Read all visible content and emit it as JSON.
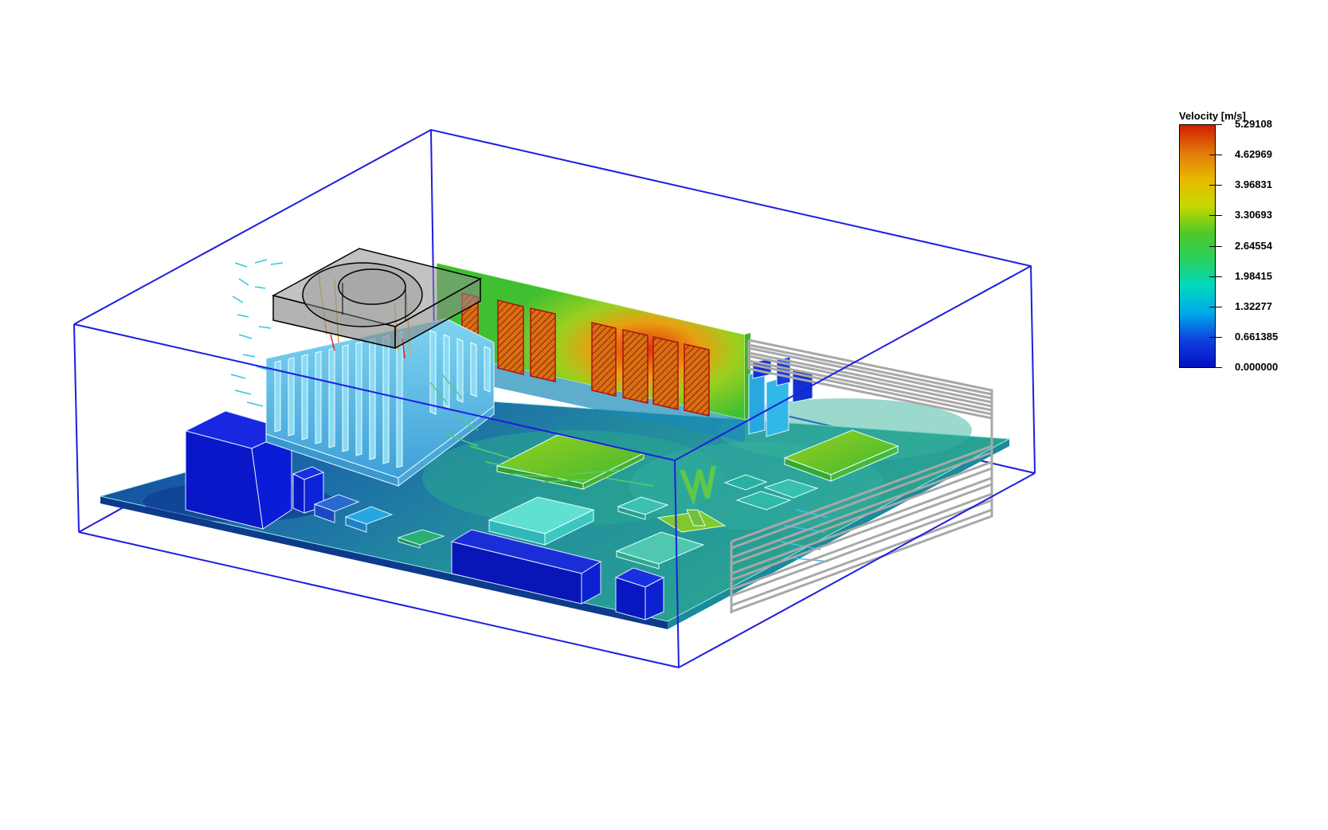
{
  "legend": {
    "title": "Velocity [m/s]",
    "values": [
      "5.29108",
      "4.62969",
      "3.96831",
      "3.30693",
      "2.64554",
      "1.98415",
      "1.32277",
      "0.661385",
      "0.000000"
    ],
    "gradient": [
      "#d21e00",
      "#e0780a",
      "#e8b800",
      "#c8d800",
      "#50c828",
      "#28d060",
      "#00d8c0",
      "#00a8e8",
      "#1040e0",
      "#0010c0"
    ]
  },
  "colors": {
    "domain_outline": "#1e1ee0",
    "board_low": "#1c6fa8",
    "board_mid": "#22a6a0",
    "fan_housing": "#808080",
    "heatsink": "#4fb8e8",
    "dimm_hot": "#e03010",
    "component_blue": "#1020d8",
    "wire_gray": "#a8a8a8"
  }
}
